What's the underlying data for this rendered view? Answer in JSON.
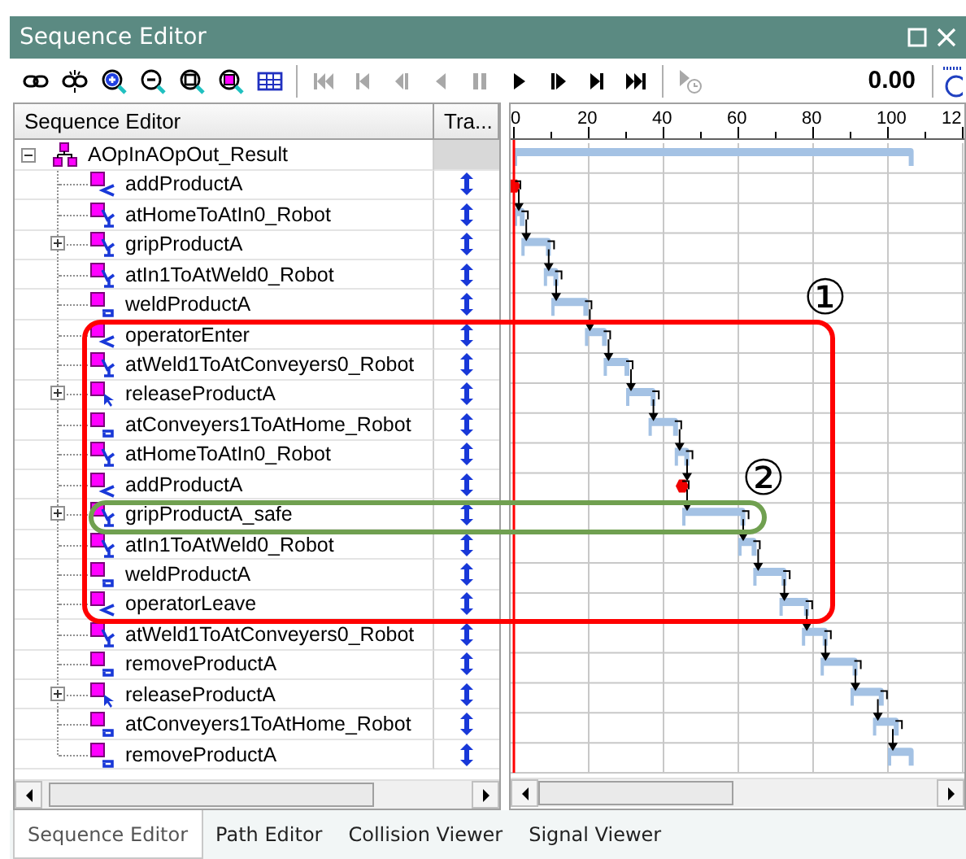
{
  "window": {
    "title": "Sequence Editor"
  },
  "toolbar": {
    "buttons": [
      {
        "kind": "link"
      },
      {
        "kind": "unlink"
      },
      {
        "kind": "zoom_in"
      },
      {
        "kind": "zoom_out"
      },
      {
        "kind": "zoom_fit"
      },
      {
        "kind": "zoom_box"
      },
      {
        "kind": "columns"
      },
      {
        "kind": "sep"
      },
      {
        "kind": "first",
        "disabled": true
      },
      {
        "kind": "prev",
        "disabled": true
      },
      {
        "kind": "step_back",
        "disabled": true
      },
      {
        "kind": "play_back",
        "disabled": true
      },
      {
        "kind": "pause",
        "disabled": true
      },
      {
        "kind": "play",
        "disabled": false
      },
      {
        "kind": "step_forward",
        "disabled": false
      },
      {
        "kind": "next",
        "disabled": false
      },
      {
        "kind": "last",
        "disabled": false
      },
      {
        "kind": "sep"
      },
      {
        "kind": "play_timer",
        "disabled": true
      }
    ],
    "time": "0.00"
  },
  "tree_columns": [
    "Sequence Editor",
    "Tra..."
  ],
  "tree": {
    "label": "AOpInAOpOut_Result",
    "kind": "compound",
    "expanded": true,
    "transition": false,
    "children": [
      {
        "label": "addProductA",
        "kind": "scissors",
        "expandable": false,
        "transition": true
      },
      {
        "label": "atHomeToAtIn0_Robot",
        "kind": "robot",
        "expandable": false,
        "transition": true
      },
      {
        "label": "gripProductA",
        "kind": "robot",
        "expandable": true,
        "expanded": false,
        "transition": true
      },
      {
        "label": "atIn1ToAtWeld0_Robot",
        "kind": "robot",
        "expandable": false,
        "transition": true
      },
      {
        "label": "weldProductA",
        "kind": "loop",
        "expandable": false,
        "transition": true
      },
      {
        "label": "operatorEnter",
        "kind": "scissors",
        "expandable": false,
        "transition": true
      },
      {
        "label": "atWeld1ToAtConveyers0_Robot",
        "kind": "robot",
        "expandable": false,
        "transition": true
      },
      {
        "label": "releaseProductA",
        "kind": "pointer",
        "expandable": true,
        "expanded": false,
        "transition": true
      },
      {
        "label": "atConveyers1ToAtHome_Robot",
        "kind": "loop",
        "expandable": false,
        "transition": true
      },
      {
        "label": "atHomeToAtIn0_Robot",
        "kind": "robot",
        "expandable": false,
        "transition": true
      },
      {
        "label": "addProductA",
        "kind": "scissors",
        "expandable": false,
        "transition": true
      },
      {
        "label": "gripProductA_safe",
        "kind": "robot",
        "expandable": true,
        "expanded": false,
        "transition": true
      },
      {
        "label": "atIn1ToAtWeld0_Robot",
        "kind": "robot",
        "expandable": false,
        "transition": true
      },
      {
        "label": "weldProductA",
        "kind": "loop",
        "expandable": false,
        "transition": true
      },
      {
        "label": "operatorLeave",
        "kind": "scissors",
        "expandable": false,
        "transition": true
      },
      {
        "label": "atWeld1ToAtConveyers0_Robot",
        "kind": "robot",
        "expandable": false,
        "transition": true
      },
      {
        "label": "removeProductA",
        "kind": "loop",
        "expandable": false,
        "transition": true
      },
      {
        "label": "releaseProductA",
        "kind": "pointer",
        "expandable": true,
        "expanded": false,
        "transition": true
      },
      {
        "label": "atConveyers1ToAtHome_Robot",
        "kind": "loop",
        "expandable": false,
        "transition": true
      },
      {
        "label": "removeProductA",
        "kind": "loop",
        "expandable": false,
        "transition": true
      }
    ]
  },
  "timeline": {
    "ruler_labels": [
      "0",
      "20",
      "40",
      "60",
      "80",
      "100",
      "12"
    ]
  },
  "callouts": [
    {
      "label": "①",
      "color": "#ff0000"
    },
    {
      "label": "②",
      "color": "#70a050"
    }
  ],
  "tabs": [
    {
      "label": "Sequence Editor",
      "selected": true
    },
    {
      "label": "Path Editor",
      "selected": false
    },
    {
      "label": "Collision Viewer",
      "selected": false
    },
    {
      "label": "Signal Viewer",
      "selected": false
    }
  ]
}
